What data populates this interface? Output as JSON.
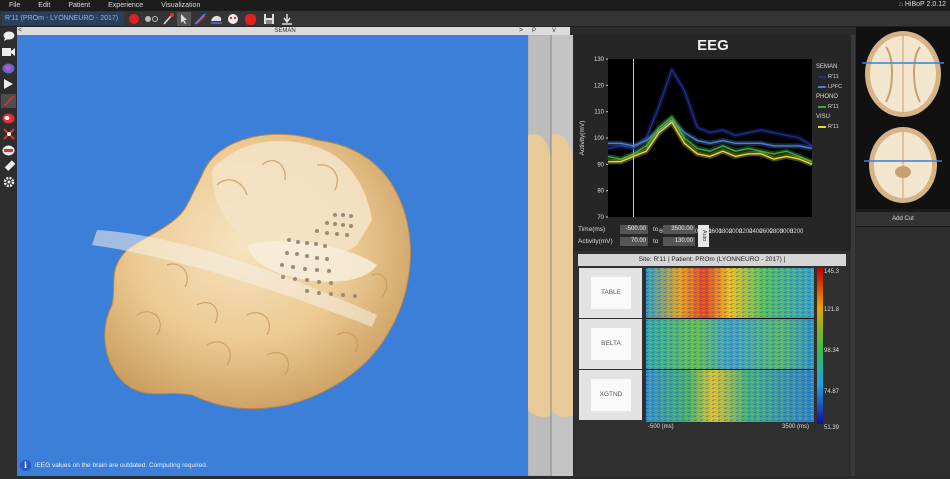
{
  "menu": [
    "File",
    "Edit",
    "Patient",
    "Experience",
    "Visualization"
  ],
  "app_version": "HiBoP 2.0.12",
  "toolbar": {
    "scene_selector": "R'11 (PROm - LYONNEURO - 2017)"
  },
  "view_header": {
    "title": "SEMAN",
    "left_arrow": "<",
    "right_arrow": ">",
    "tab_p": "P",
    "tab_v": "V"
  },
  "status": {
    "icon_label": "i",
    "message": "iEEG values on the brain are outdated. Computing required."
  },
  "eeg": {
    "title": "EEG",
    "controls": {
      "time_label": "Time(ms)",
      "time_from": "-500.00",
      "to_label": "to",
      "time_to": "3500.00",
      "activity_label": "Activity(mV)",
      "activity_from": "70.00",
      "activity_to": "130.00",
      "auto_label": "Auto"
    },
    "legend": [
      {
        "group": "SEMAN",
        "items": [
          {
            "name": "R'11",
            "color": "#1e2f8a"
          },
          {
            "name": "LPFC",
            "color": "#4a7fd0"
          }
        ]
      },
      {
        "group": "PHONO",
        "items": [
          {
            "name": "R'11",
            "color": "#3fa83f"
          }
        ]
      },
      {
        "group": "VISU",
        "items": [
          {
            "name": "R'11",
            "color": "#e0d83a"
          }
        ]
      }
    ]
  },
  "chart_data": {
    "type": "line",
    "title": "EEG",
    "xlabel": "",
    "ylabel": "Activity(mV)",
    "xlim": [
      -500,
      3500
    ],
    "ylim": [
      70,
      130
    ],
    "x_ticks": [
      600,
      800,
      1000,
      1200,
      1400,
      1600,
      1800,
      2000,
      2200,
      2400,
      2600,
      2800,
      3000,
      3200
    ],
    "y_ticks": [
      70,
      80,
      90,
      100,
      110,
      120,
      130
    ],
    "x": [
      -500,
      -250,
      0,
      250,
      500,
      750,
      1000,
      1250,
      1500,
      1750,
      2000,
      2250,
      2500,
      2750,
      3000,
      3250,
      3500
    ],
    "series": [
      {
        "name": "R'11",
        "group": "SEMAN",
        "color": "#1e2f8a",
        "values": [
          96,
          97,
          96,
          100,
          112,
          126,
          118,
          104,
          102,
          103,
          101,
          102,
          103,
          102,
          101,
          100,
          97
        ]
      },
      {
        "name": "LPFC",
        "group": "SEMAN",
        "color": "#4a7fd0",
        "values": [
          98,
          98,
          97,
          99,
          103,
          107,
          102,
          99,
          98,
          99,
          98,
          98,
          98,
          97,
          97,
          97,
          96
        ]
      },
      {
        "name": "R'11",
        "group": "PHONO",
        "color": "#3fa83f",
        "values": [
          93,
          92,
          94,
          97,
          104,
          108,
          100,
          96,
          95,
          97,
          95,
          96,
          95,
          94,
          95,
          93,
          91
        ]
      },
      {
        "name": "R'11",
        "group": "VISU",
        "color": "#e0d83a",
        "values": [
          91,
          91,
          93,
          95,
          102,
          106,
          98,
          94,
          93,
          95,
          93,
          94,
          94,
          92,
          93,
          92,
          90
        ]
      }
    ]
  },
  "timefreq": {
    "header": "Site: R'11   |   Patient: PROm (LYONNEURO - 2017)   |",
    "rows": [
      "TABLE",
      "BELTA",
      "XGTND"
    ],
    "x_min": "-500 (ms)",
    "x_max": "3500 (ms)",
    "colorbar": [
      "145.3",
      "121.8",
      "98.34",
      "74.87",
      "51.39"
    ]
  },
  "cuts": {
    "add_cut_label": "Add Cut"
  }
}
